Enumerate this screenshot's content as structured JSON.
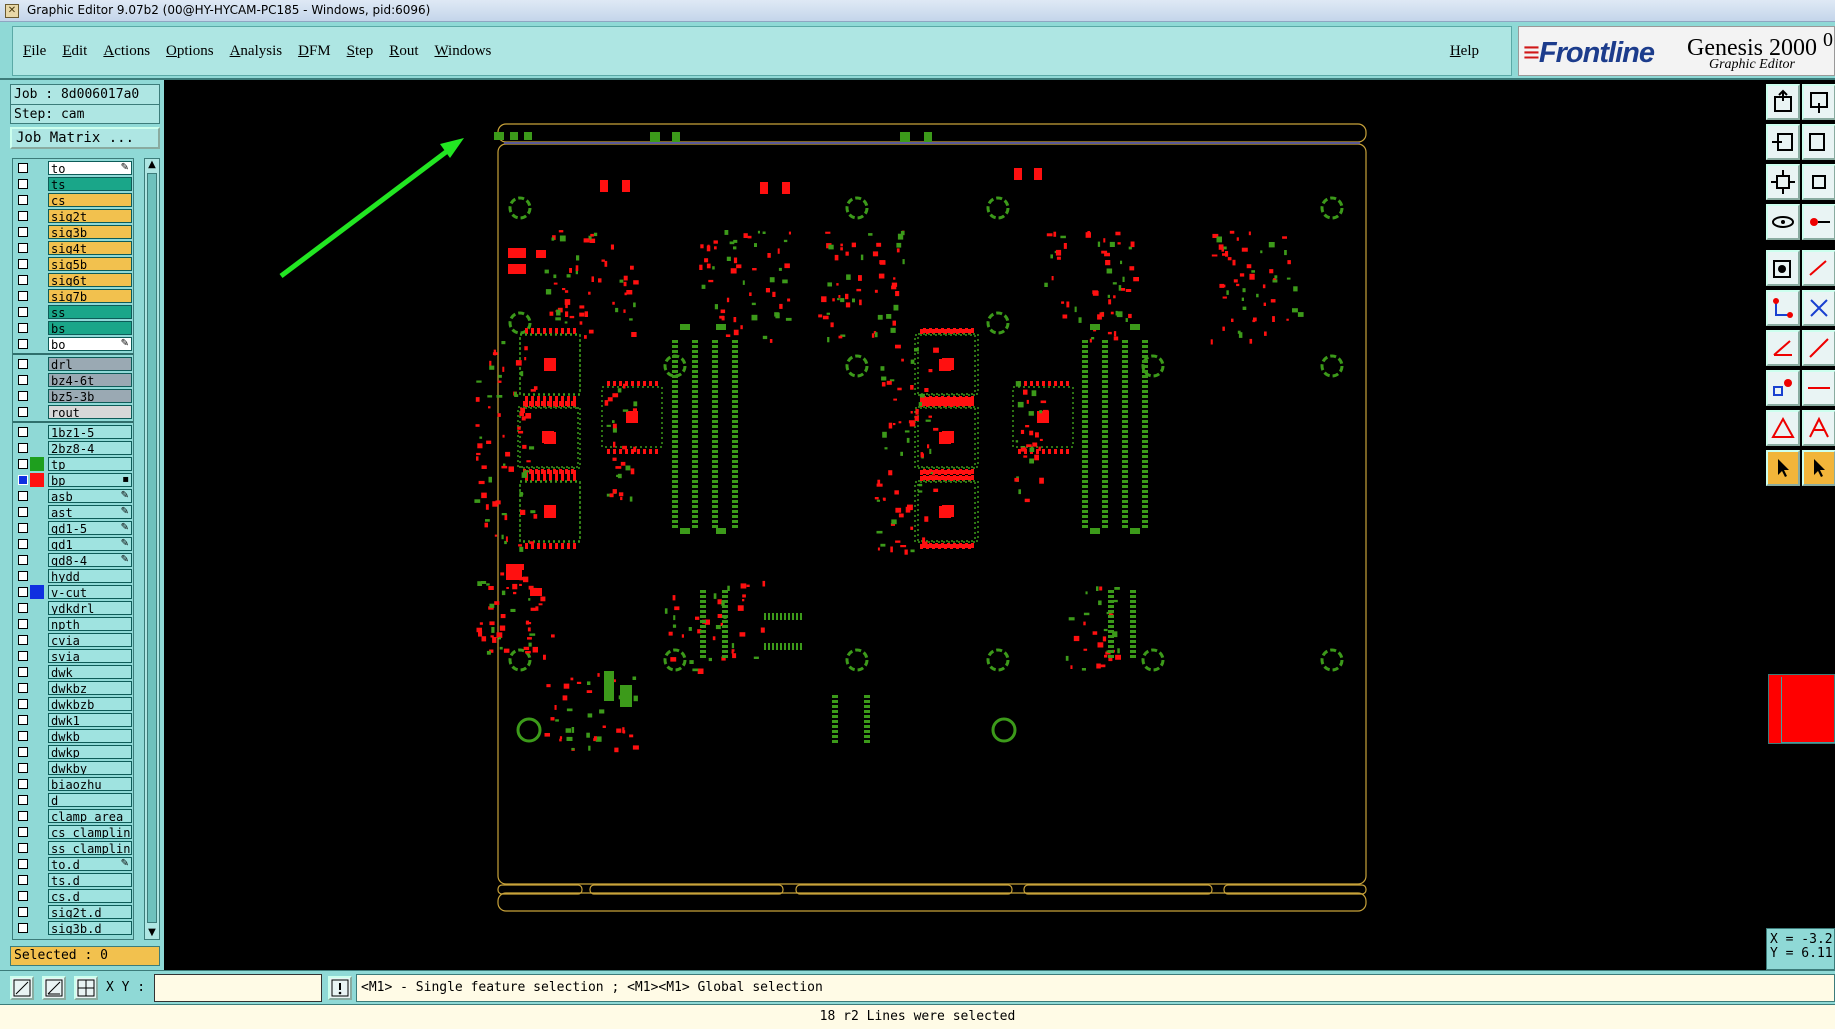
{
  "window": {
    "title": "Graphic Editor 9.07b2 (00@HY-HYCAM-PC185 - Windows, pid:6096)"
  },
  "menu": {
    "items": [
      "File",
      "Edit",
      "Actions",
      "Options",
      "Analysis",
      "DFM",
      "Step",
      "Rout",
      "Windows"
    ],
    "help": "Help"
  },
  "brand": {
    "logo": "Frontline",
    "product": "Genesis 2000",
    "version_mark": "0",
    "subtitle": "Graphic Editor"
  },
  "job": {
    "job_line": "Job : 8d006017a0",
    "step_line": "Step: cam",
    "matrix_button": "Job Matrix ..."
  },
  "layers": [
    {
      "name": "to",
      "color": "#ffffff",
      "mark": "✎"
    },
    {
      "name": "ts",
      "color": "#1aa689",
      "mark": ""
    },
    {
      "name": "cs",
      "color": "#f2c14e",
      "mark": ""
    },
    {
      "name": "sig2t",
      "color": "#f2c14e",
      "mark": ""
    },
    {
      "name": "sig3b",
      "color": "#f2c14e",
      "mark": ""
    },
    {
      "name": "sig4t",
      "color": "#f2c14e",
      "mark": ""
    },
    {
      "name": "sig5b",
      "color": "#f2c14e",
      "mark": ""
    },
    {
      "name": "sig6t",
      "color": "#f2c14e",
      "mark": ""
    },
    {
      "name": "sig7b",
      "color": "#f2c14e",
      "mark": ""
    },
    {
      "name": "ss",
      "color": "#1aa689",
      "mark": ""
    },
    {
      "name": "bs",
      "color": "#1aa689",
      "mark": ""
    },
    {
      "name": "bo",
      "color": "#ffffff",
      "mark": "✎"
    },
    {
      "name": "drl",
      "color": "#9aa9b3",
      "mark": ""
    },
    {
      "name": "bz4-6t",
      "color": "#9aa9b3",
      "mark": ""
    },
    {
      "name": "bz5-3b",
      "color": "#9aa9b3",
      "mark": ""
    },
    {
      "name": "rout",
      "color": "#d8d8d8",
      "mark": ""
    },
    {
      "name": "1bz1-5",
      "color": "#9fe3e0",
      "mark": ""
    },
    {
      "name": "2bz8-4",
      "color": "#9fe3e0",
      "mark": ""
    },
    {
      "name": "tp",
      "color": "#9fe3e0",
      "mark": ""
    },
    {
      "name": "bp",
      "color": "#9fe3e0",
      "mark": "▪"
    },
    {
      "name": "asb",
      "color": "#9fe3e0",
      "mark": "✎"
    },
    {
      "name": "ast",
      "color": "#9fe3e0",
      "mark": "✎"
    },
    {
      "name": "gd1-5",
      "color": "#9fe3e0",
      "mark": "✎"
    },
    {
      "name": "gd1",
      "color": "#9fe3e0",
      "mark": "✎"
    },
    {
      "name": "gd8-4",
      "color": "#9fe3e0",
      "mark": "✎"
    },
    {
      "name": "hydd",
      "color": "#9fe3e0",
      "mark": ""
    },
    {
      "name": "v-cut",
      "color": "#9fe3e0",
      "mark": ""
    },
    {
      "name": "ydkdrl",
      "color": "#9fe3e0",
      "mark": ""
    },
    {
      "name": "npth",
      "color": "#9fe3e0",
      "mark": ""
    },
    {
      "name": "cvia",
      "color": "#9fe3e0",
      "mark": ""
    },
    {
      "name": "svia",
      "color": "#9fe3e0",
      "mark": ""
    },
    {
      "name": "dwk",
      "color": "#9fe3e0",
      "mark": ""
    },
    {
      "name": "dwkbz",
      "color": "#9fe3e0",
      "mark": ""
    },
    {
      "name": "dwkbzb",
      "color": "#9fe3e0",
      "mark": ""
    },
    {
      "name": "dwk1",
      "color": "#9fe3e0",
      "mark": ""
    },
    {
      "name": "dwkb",
      "color": "#9fe3e0",
      "mark": ""
    },
    {
      "name": "dwkp",
      "color": "#9fe3e0",
      "mark": ""
    },
    {
      "name": "dwkby",
      "color": "#9fe3e0",
      "mark": ""
    },
    {
      "name": "biaozhu",
      "color": "#9fe3e0",
      "mark": ""
    },
    {
      "name": "d",
      "color": "#9fe3e0",
      "mark": ""
    },
    {
      "name": "clamp_area",
      "color": "#9fe3e0",
      "mark": ""
    },
    {
      "name": "cs_clampline",
      "color": "#9fe3e0",
      "mark": ""
    },
    {
      "name": "ss_clampline",
      "color": "#9fe3e0",
      "mark": ""
    },
    {
      "name": "to.d",
      "color": "#9fe3e0",
      "mark": "✎"
    },
    {
      "name": "ts.d",
      "color": "#9fe3e0",
      "mark": ""
    },
    {
      "name": "cs.d",
      "color": "#9fe3e0",
      "mark": ""
    },
    {
      "name": "sig2t.d",
      "color": "#9fe3e0",
      "mark": ""
    },
    {
      "name": "sig3b.d",
      "color": "#9fe3e0",
      "mark": ""
    }
  ],
  "layer_swatches": {
    "tp": "#1e9f1e",
    "bp": "#ff1010",
    "v-cut": "#1030e0"
  },
  "selected_count": "Selected : 0",
  "coords": {
    "x_line": "X = -3.2",
    "y_line": "Y = 6.11"
  },
  "command": {
    "xy_label": "X Y :",
    "xy_value": "",
    "hint": "<M1> - Single feature selection ; <M1><M1> Global selection"
  },
  "status": {
    "message": "18 r2 Lines were selected"
  },
  "colors": {
    "panel": "#8fd9d6",
    "outline": "#c8a23a",
    "pad_red": "#ff1010",
    "pad_green": "#3c9a1a",
    "arrow": "#22e622"
  }
}
